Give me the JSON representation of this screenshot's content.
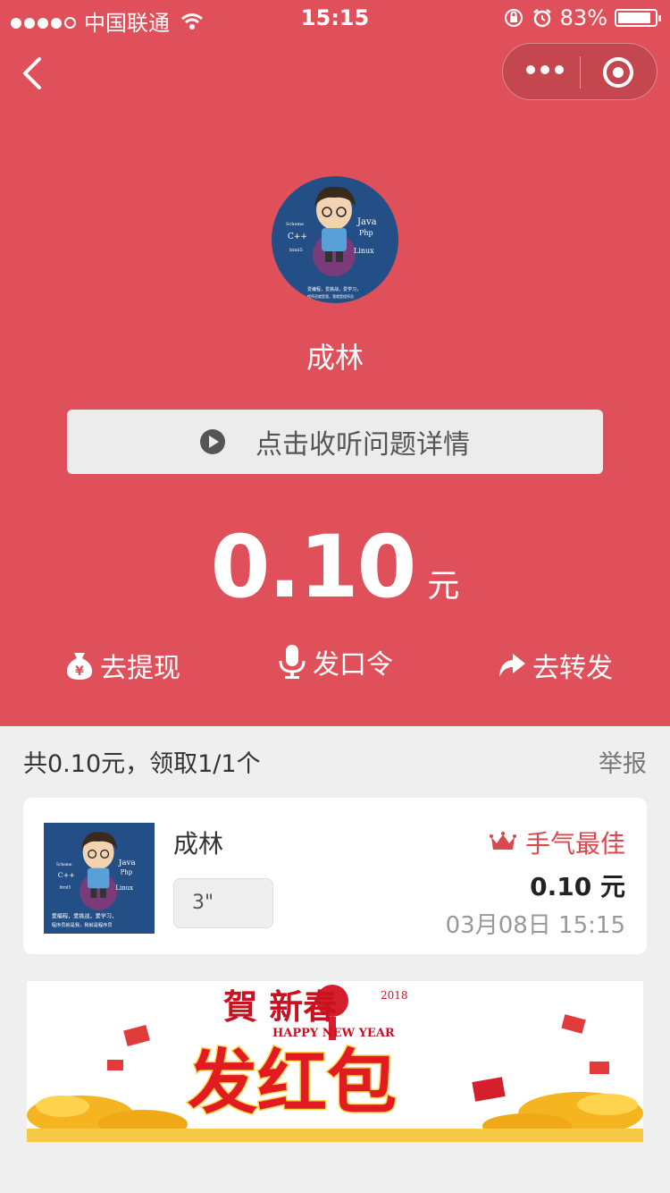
{
  "status_bar": {
    "carrier": "中国联通",
    "time": "15:15",
    "battery": "83%"
  },
  "header": {
    "sender_name": "成林"
  },
  "listen_button": {
    "label": "点击收听问题详情"
  },
  "amount": {
    "value": "0.10",
    "unit": "元"
  },
  "actions": [
    {
      "label": "去提现",
      "icon": "money-bag-icon"
    },
    {
      "label": "发口令",
      "icon": "microphone-icon"
    },
    {
      "label": "去转发",
      "icon": "share-arrow-icon"
    }
  ],
  "summary": {
    "text": "共0.10元，领取1/1个",
    "report": "举报"
  },
  "receiver": {
    "name": "成林",
    "voice_duration": "3\"",
    "best_label": "手气最佳",
    "amount": "0.10 元",
    "time": "03月08日 15:15"
  },
  "avatar_text": {
    "java": "Java",
    "php": "Php",
    "cpp": "C++",
    "scheme": "Scheme",
    "html": "html5",
    "linux": "Linux",
    "motto1": "爱编程，爱挑战，爱学习，",
    "motto2": "程序员就是我，我就是程序员"
  },
  "banner": {
    "top_text": "賀 新春",
    "year": "2018",
    "subtitle": "HAPPY NEW YEAR",
    "main_text": "发红包"
  },
  "colors": {
    "primary_red": "#e0505a",
    "accent_red": "#d9474f",
    "avatar_bg": "#234f86"
  }
}
